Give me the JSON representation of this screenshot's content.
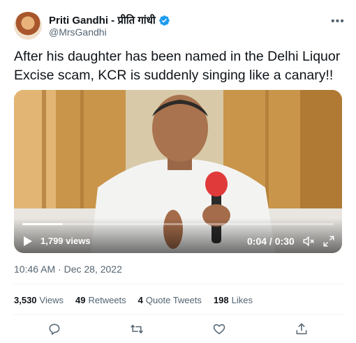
{
  "tweet": {
    "author_name": "Priti Gandhi - प्रीति गांधी",
    "handle": "@MrsGandhi",
    "text": "After his daughter has been named in the Delhi Liquor Excise scam, KCR is suddenly singing like a canary!!",
    "timestamp": "10:46 AM · Dec 28, 2022"
  },
  "video": {
    "views": "1,799 views",
    "time": "0:04 / 0:30",
    "progress": 0.13
  },
  "stats": {
    "views_count": "3,530",
    "views_label": "Views",
    "retweets_count": "49",
    "retweets_label": "Retweets",
    "quotes_count": "4",
    "quotes_label": "Quote Tweets",
    "likes_count": "198",
    "likes_label": "Likes"
  },
  "colors": {
    "verified": "#1d9bf0",
    "secondary_text": "#536471",
    "primary_text": "#0f1419"
  },
  "icons": [
    "verified-badge-icon",
    "more-icon",
    "play-icon",
    "volume-off-icon",
    "expand-icon",
    "reply-icon",
    "retweet-icon",
    "like-icon",
    "share-icon"
  ]
}
